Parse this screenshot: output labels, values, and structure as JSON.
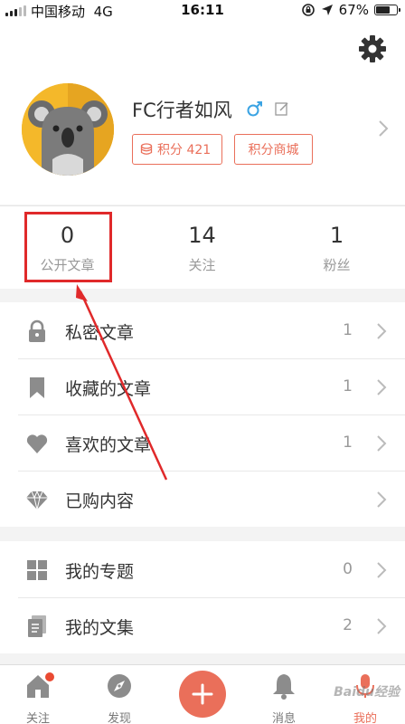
{
  "status_bar": {
    "carrier": "中国移动",
    "network": "4G",
    "time": "16:11",
    "battery_text": "67%",
    "battery_level": 0.67
  },
  "profile": {
    "username": "FC行者如风",
    "gender_icon": "male-icon",
    "points_label": "积分 421",
    "mall_label": "积分商城"
  },
  "stats": [
    {
      "value": "0",
      "label": "公开文章"
    },
    {
      "value": "14",
      "label": "关注"
    },
    {
      "value": "1",
      "label": "粉丝"
    }
  ],
  "menu_group_1": [
    {
      "label": "私密文章",
      "count": "1",
      "icon": "lock-icon"
    },
    {
      "label": "收藏的文章",
      "count": "1",
      "icon": "bookmark-icon"
    },
    {
      "label": "喜欢的文章",
      "count": "1",
      "icon": "heart-icon"
    },
    {
      "label": "已购内容",
      "count": "",
      "icon": "diamond-icon"
    }
  ],
  "menu_group_2": [
    {
      "label": "我的专题",
      "count": "0",
      "icon": "grid-icon"
    },
    {
      "label": "我的文集",
      "count": "2",
      "icon": "notebook-icon"
    }
  ],
  "tabs": [
    {
      "label": "关注",
      "icon": "home-icon"
    },
    {
      "label": "发现",
      "icon": "compass-icon"
    },
    {
      "label": "",
      "icon": "plus-icon"
    },
    {
      "label": "消息",
      "icon": "bell-icon"
    },
    {
      "label": "我的",
      "icon": "person-icon"
    }
  ],
  "watermark": "Baidu经验",
  "colors": {
    "accent": "#ea6f5a",
    "annotation_red": "#e0292a",
    "avatar_bg": "#f4b82a"
  }
}
